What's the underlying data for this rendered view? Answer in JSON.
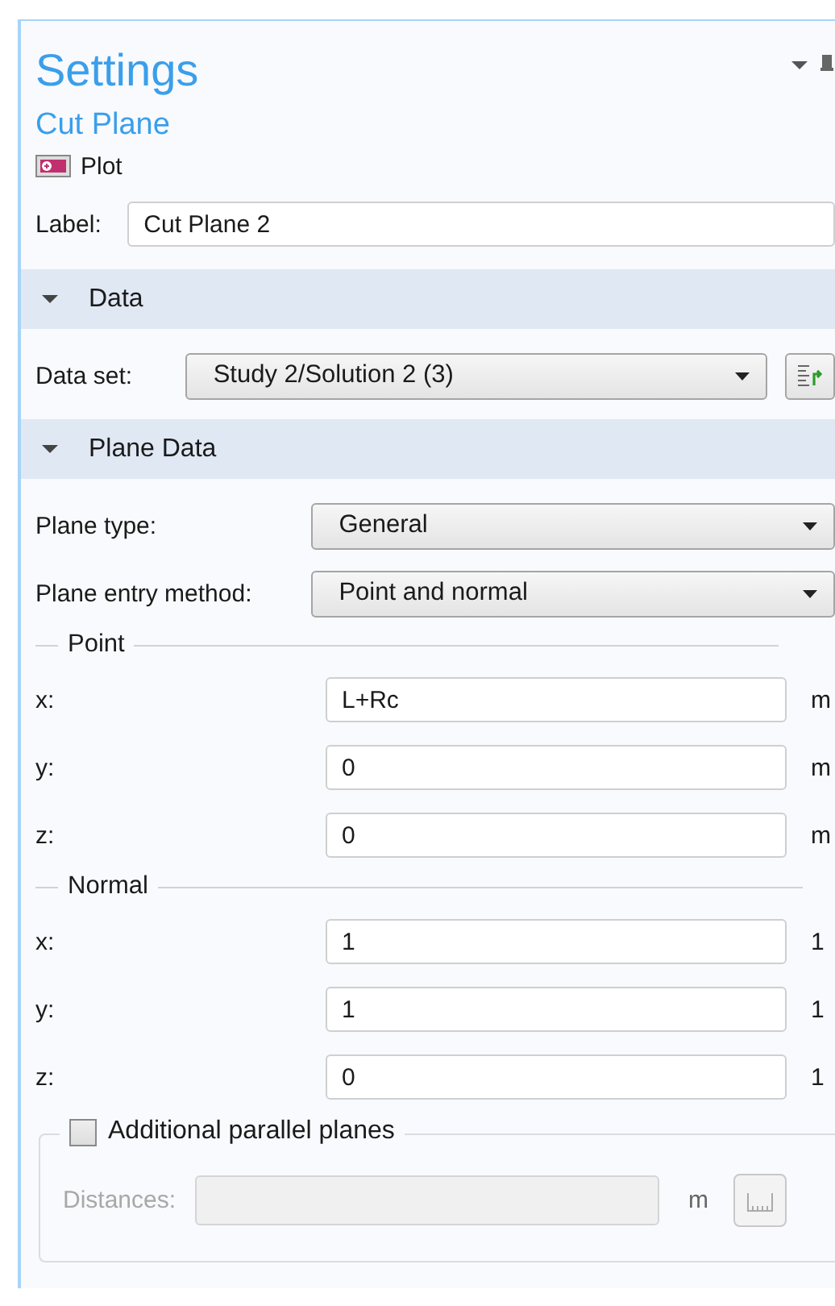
{
  "panel": {
    "title": "Settings",
    "subtitle": "Cut Plane",
    "node_type": "Plot"
  },
  "label_field": {
    "label": "Label:",
    "value": "Cut Plane 2"
  },
  "sections": [
    {
      "title": "Data",
      "expanded": true,
      "rows": [
        {
          "kind": "combo",
          "label": "Data set:",
          "value": "Study 2/Solution 2 (3)",
          "has_button": true
        }
      ]
    },
    {
      "title": "Plane Data",
      "expanded": true,
      "rows": [
        {
          "kind": "combo",
          "label": "Plane type:",
          "value": "General"
        },
        {
          "kind": "combo",
          "label": "Plane entry method:",
          "value": "Point and normal"
        },
        {
          "kind": "group",
          "title": "Point",
          "fields": [
            {
              "label": "x:",
              "value": "L+Rc",
              "unit": "m"
            },
            {
              "label": "y:",
              "value": "0",
              "unit": "m"
            },
            {
              "label": "z:",
              "value": "0",
              "unit": "m"
            }
          ]
        },
        {
          "kind": "group",
          "title": "Normal",
          "fields": [
            {
              "label": "x:",
              "value": "1",
              "unit": "1"
            },
            {
              "label": "y:",
              "value": "1",
              "unit": "1"
            },
            {
              "label": "z:",
              "value": "0",
              "unit": "1"
            }
          ]
        },
        {
          "kind": "option",
          "label": "Additional parallel planes",
          "checked": false,
          "field_label": "Distances:",
          "unit": "m"
        }
      ]
    }
  ]
}
